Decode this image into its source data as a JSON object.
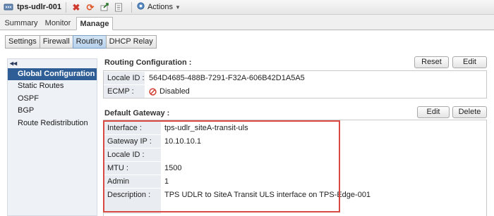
{
  "titlebar": {
    "title": "tps-udlr-001",
    "actions_label": "Actions",
    "icons": [
      "router-icon",
      "delete-icon",
      "refresh-icon",
      "export-icon",
      "clipboard-icon",
      "gear-icon",
      "chevron-down-icon"
    ]
  },
  "main_tabs": [
    "Summary",
    "Monitor",
    "Manage"
  ],
  "active_main_tab": "Manage",
  "sub_tabs": [
    "Settings",
    "Firewall",
    "Routing",
    "DHCP Relay"
  ],
  "active_sub_tab": "Routing",
  "nav": {
    "collapse_glyph": "◂◂",
    "items": [
      "Global Configuration",
      "Static Routes",
      "OSPF",
      "BGP",
      "Route Redistribution"
    ],
    "active": "Global Configuration"
  },
  "routing_config": {
    "title": "Routing Configuration :",
    "reset_label": "Reset",
    "edit_label": "Edit",
    "locale_id_label": "Locale ID :",
    "locale_id_value": "564D4685-488B-7291-F32A-606B42D1A5A5",
    "ecmp_label": "ECMP :",
    "ecmp_value": "Disabled"
  },
  "default_gateway": {
    "title": "Default Gateway :",
    "edit_label": "Edit",
    "delete_label": "Delete",
    "fields": [
      {
        "label": "Interface :",
        "value": "tps-udlr_siteA-transit-uls"
      },
      {
        "label": "Gateway IP :",
        "value": "10.10.10.1"
      },
      {
        "label": "Locale ID :",
        "value": ""
      },
      {
        "label": "MTU :",
        "value": "1500"
      },
      {
        "label": "Admin Distance:",
        "value": "1"
      },
      {
        "label": "Description :",
        "value": "TPS UDLR to SiteA Transit ULS interface on TPS-Edge-001"
      }
    ]
  },
  "colors": {
    "accent": "#2f5e96",
    "highlight": "#d94a43",
    "label_bg": "#e9ecf1"
  }
}
